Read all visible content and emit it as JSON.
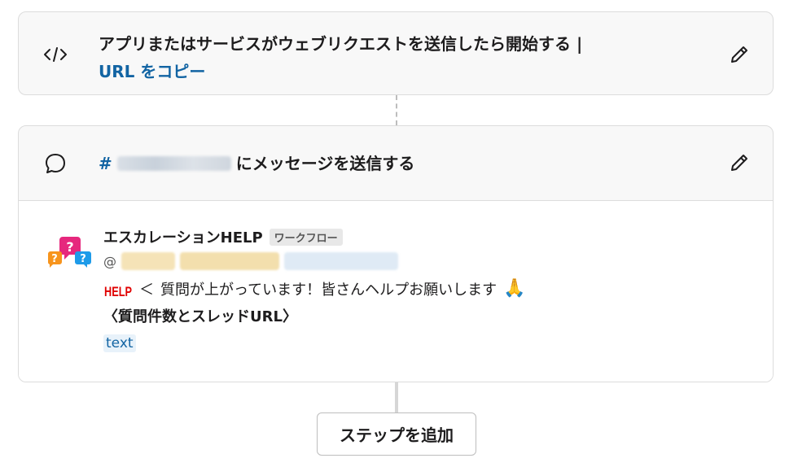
{
  "trigger": {
    "title": "アプリまたはサービスがウェブリクエストを送信したら開始する |",
    "copy_link": "URL をコピー",
    "icon": "code-icon",
    "edit_icon": "pencil-icon"
  },
  "step": {
    "hash": "#",
    "action_text": "にメッセージを送信する",
    "icon": "chat-bubble-icon",
    "edit_icon": "pencil-icon"
  },
  "message": {
    "sender": "エスカレーションHELP",
    "badge": "ワークフロー",
    "mention_prefix": "@",
    "help_logo_text": "HELP",
    "arrow": "＜",
    "text": "質問が上がっています！皆さんヘルプお願いします",
    "pray_emoji": "🙏",
    "bold_line": "〈質問件数とスレッドURL〉",
    "variable_chip": "text"
  },
  "add_step_label": "ステップを追加",
  "colors": {
    "link": "#1264a3",
    "card_bg": "#f8f8f8",
    "border": "#dcdcdc"
  }
}
